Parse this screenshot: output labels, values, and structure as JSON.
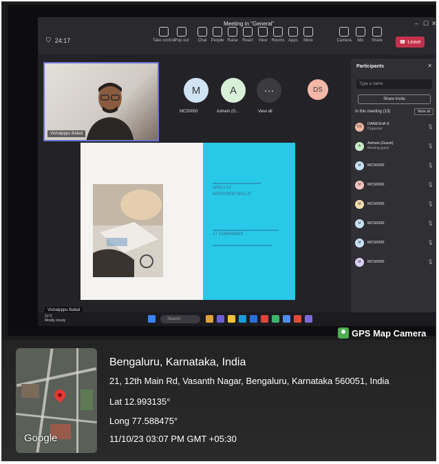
{
  "meeting": {
    "title": "Meeting in \"General\"",
    "clock": "24:17",
    "toolbar": [
      {
        "label": "Take control",
        "icon": "monitor-icon"
      },
      {
        "label": "Pop out",
        "icon": "popout-icon"
      },
      {
        "label": "Chat",
        "icon": "chat-icon"
      },
      {
        "label": "People",
        "icon": "people-icon"
      },
      {
        "label": "Raise",
        "icon": "hand-icon"
      },
      {
        "label": "React",
        "icon": "react-icon"
      },
      {
        "label": "View",
        "icon": "view-icon"
      },
      {
        "label": "Rooms",
        "icon": "rooms-icon"
      },
      {
        "label": "Apps",
        "icon": "apps-icon"
      },
      {
        "label": "More",
        "icon": "more-icon"
      },
      {
        "label": "Camera",
        "icon": "camera-icon"
      },
      {
        "label": "Mic",
        "icon": "mic-icon"
      },
      {
        "label": "Share",
        "icon": "share-icon"
      }
    ],
    "leave_label": "Leave",
    "self_name": "Vishalpppu Ballali",
    "presenter_name": "Vishalpppu Ballali",
    "avatars": [
      {
        "initial": "M",
        "label": "MCS0000",
        "color": "#cfe3f5"
      },
      {
        "initial": "A",
        "label": "Ashwin (G...",
        "color": "#d8efd8"
      },
      {
        "initial": "···",
        "label": "View all",
        "color": "#3a3a3f"
      },
      {
        "initial": "DS",
        "label": "",
        "color": "#f5b7a6"
      }
    ],
    "slide": {
      "line1": "APPLY AT",
      "line2": "INTERVIEW SKILLS",
      "line3": "AT COMPANIES"
    },
    "participants": {
      "title": "Participants",
      "search_placeholder": "Type a name",
      "share_invite": "Share invite",
      "in_meeting": "In this meeting (13)",
      "mute_all": "Mute all",
      "list": [
        {
          "name": "DANESHA S",
          "role": "Organizer",
          "initial": "DS",
          "color": "#f5b7a6"
        },
        {
          "name": "Ashwin (Guest)",
          "role": "Meeting guest",
          "initial": "A",
          "color": "#c8ecc8"
        },
        {
          "name": "MCS0000",
          "role": "",
          "initial": "M",
          "color": "#c8e2f5"
        },
        {
          "name": "MCS0000",
          "role": "",
          "initial": "M",
          "color": "#f5c2c2"
        },
        {
          "name": "MCS0000",
          "role": "",
          "initial": "M",
          "color": "#f5deb0"
        },
        {
          "name": "MCS0000",
          "role": "",
          "initial": "M",
          "color": "#c8e2f5"
        },
        {
          "name": "MCS0000",
          "role": "",
          "initial": "M",
          "color": "#c8e2f5"
        },
        {
          "name": "MCS0000",
          "role": "",
          "initial": "M",
          "color": "#dcd0f5"
        }
      ]
    },
    "taskbar": {
      "weather": "31°C",
      "weather_sub": "Mostly cloudy",
      "search": "Search"
    }
  },
  "gps": {
    "badge": "GPS Map Camera",
    "city": "Bengaluru, Karnataka, India",
    "address": "21, 12th Main Rd, Vasanth Nagar, Bengaluru, Karnataka 560051, India",
    "lat": "Lat 12.993135°",
    "long": "Long 77.588475°",
    "datetime": "11/10/23 03:07 PM GMT +05:30",
    "map_label": "Google"
  }
}
